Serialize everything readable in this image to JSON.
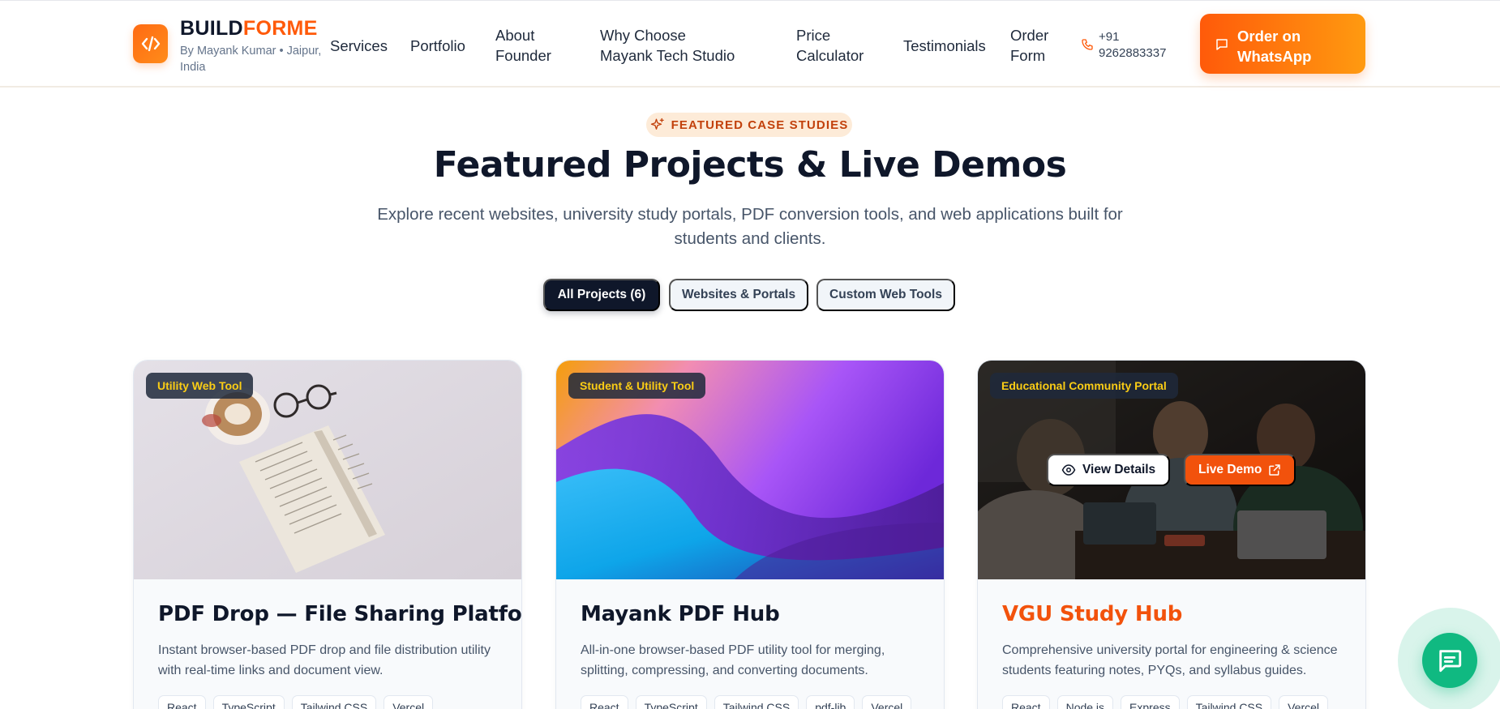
{
  "header": {
    "brand_prefix": "BUILD",
    "brand_suffix": "FORME",
    "tagline": "By Mayank Kumar • Jaipur, India",
    "logo_icon": "code-icon",
    "nav": {
      "services": "Services",
      "portfolio": "Portfolio",
      "about": "About Founder",
      "why": "Why Choose Mayank Tech Studio",
      "price": "Price Calculator",
      "testimonials": "Testimonials",
      "order": "Order Form"
    },
    "phone": "+91 9262883337",
    "whatsapp_label": "Order on WhatsApp",
    "accent_color": "#ff5a0a"
  },
  "section": {
    "eyebrow": "FEATURED CASE STUDIES",
    "title": "Featured Projects & Live Demos",
    "subtitle": "Explore recent websites, university study portals, PDF conversion tools, and web applications built for students and clients."
  },
  "filters": {
    "all": "All Projects (6)",
    "websites": "Websites & Portals",
    "tools": "Custom Web Tools"
  },
  "projects": [
    {
      "category": "Utility Web Tool",
      "title": "PDF Drop — File Sharing Platform",
      "description": "Instant browser-based PDF drop and file distribution utility with real-time links and document view.",
      "tags": [
        "React",
        "TypeScript",
        "Tailwind CSS",
        "Vercel"
      ]
    },
    {
      "category": "Student & Utility Tool",
      "title": "Mayank PDF Hub",
      "description": "All-in-one browser-based PDF utility tool for merging, splitting, compressing, and converting documents.",
      "tags": [
        "React",
        "TypeScript",
        "Tailwind CSS",
        "pdf-lib",
        "Vercel"
      ]
    },
    {
      "category": "Educational Community Portal",
      "title": "VGU Study Hub",
      "description": "Comprehensive university portal for engineering & science students featuring notes, PYQs, and syllabus guides.",
      "tags": [
        "React",
        "Node.js",
        "Express",
        "Tailwind CSS",
        "Vercel"
      ],
      "view_details": "View Details",
      "live_demo": "Live Demo"
    }
  ]
}
